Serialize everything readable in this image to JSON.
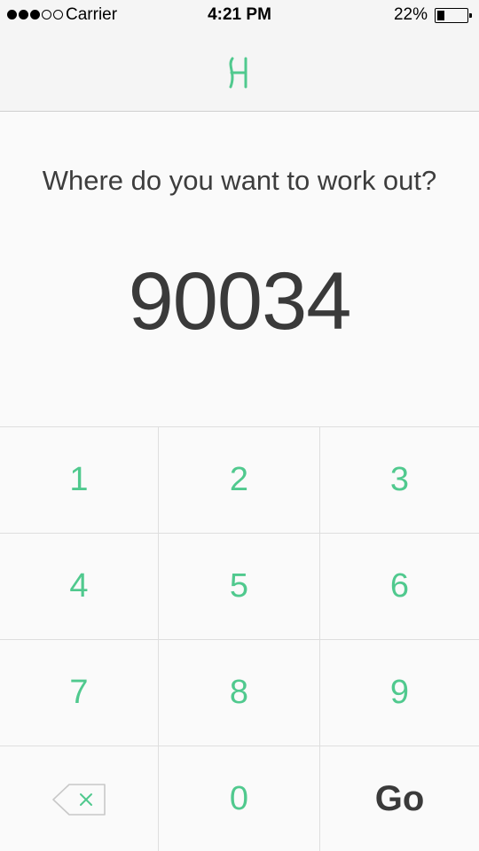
{
  "status_bar": {
    "carrier": "Carrier",
    "time": "4:21 PM",
    "battery_percent": "22%",
    "battery_level": 0.22,
    "signal_strength": 3,
    "signal_max": 5
  },
  "nav": {
    "logo_icon": "brand-logo-icon"
  },
  "prompt": "Where do you want to work out?",
  "zip_code": "90034",
  "keypad": {
    "keys": [
      "1",
      "2",
      "3",
      "4",
      "5",
      "6",
      "7",
      "8",
      "9",
      "0"
    ],
    "go_label": "Go",
    "backspace_icon": "backspace-icon"
  },
  "colors": {
    "accent": "#50c98e",
    "text": "#3a3a3a",
    "background": "#fafafa",
    "bar": "#f5f5f5"
  }
}
